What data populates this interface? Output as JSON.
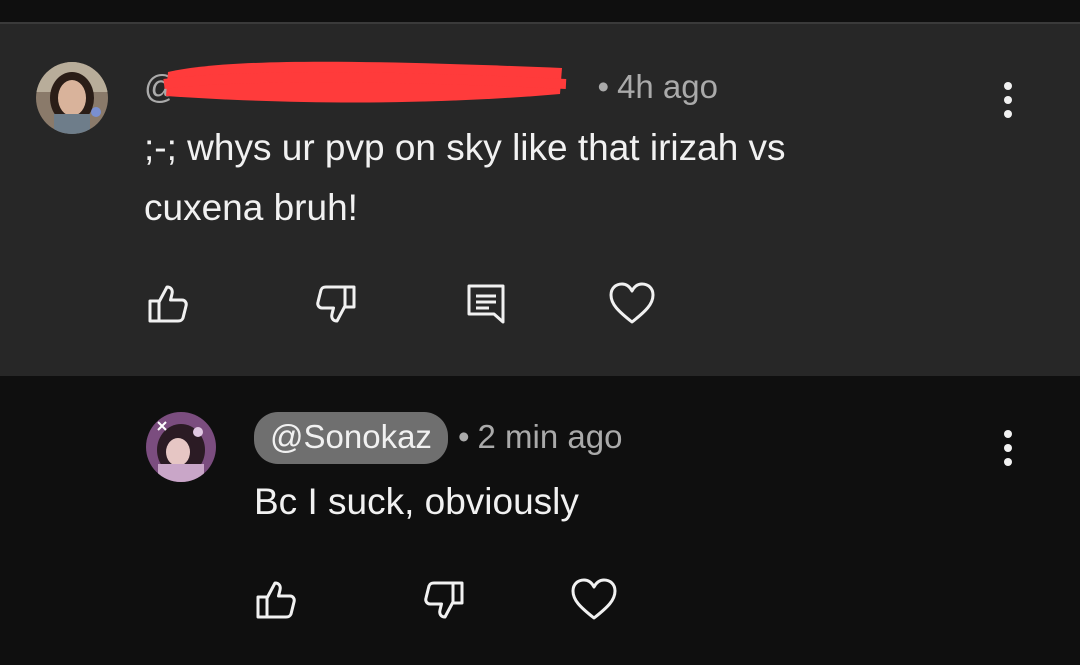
{
  "parent_comment": {
    "handle": "@",
    "handle_redacted": true,
    "time": "4h ago",
    "text_line1": ";-; whys ur pvp on sky like that irizah vs",
    "text_line2": "cuxena  bruh!",
    "avatar": "profile-photo",
    "actions": [
      "thumbs-up-icon",
      "thumbs-down-icon",
      "reply-icon",
      "heart-icon"
    ]
  },
  "reply_comment": {
    "handle": "@Sonokaz",
    "time": "2 min ago",
    "text": "Bc I suck, obviously",
    "avatar": "anime-avatar",
    "actions": [
      "thumbs-up-icon",
      "thumbs-down-icon",
      "heart-icon"
    ]
  },
  "separator": "•",
  "colors": {
    "background": "#0f0f0f",
    "parent_background": "#272727",
    "text": "#f1f1f1",
    "meta": "#aaaaaa",
    "handle_chip": "#6f6f6f",
    "redaction": "#ff3b3b"
  }
}
